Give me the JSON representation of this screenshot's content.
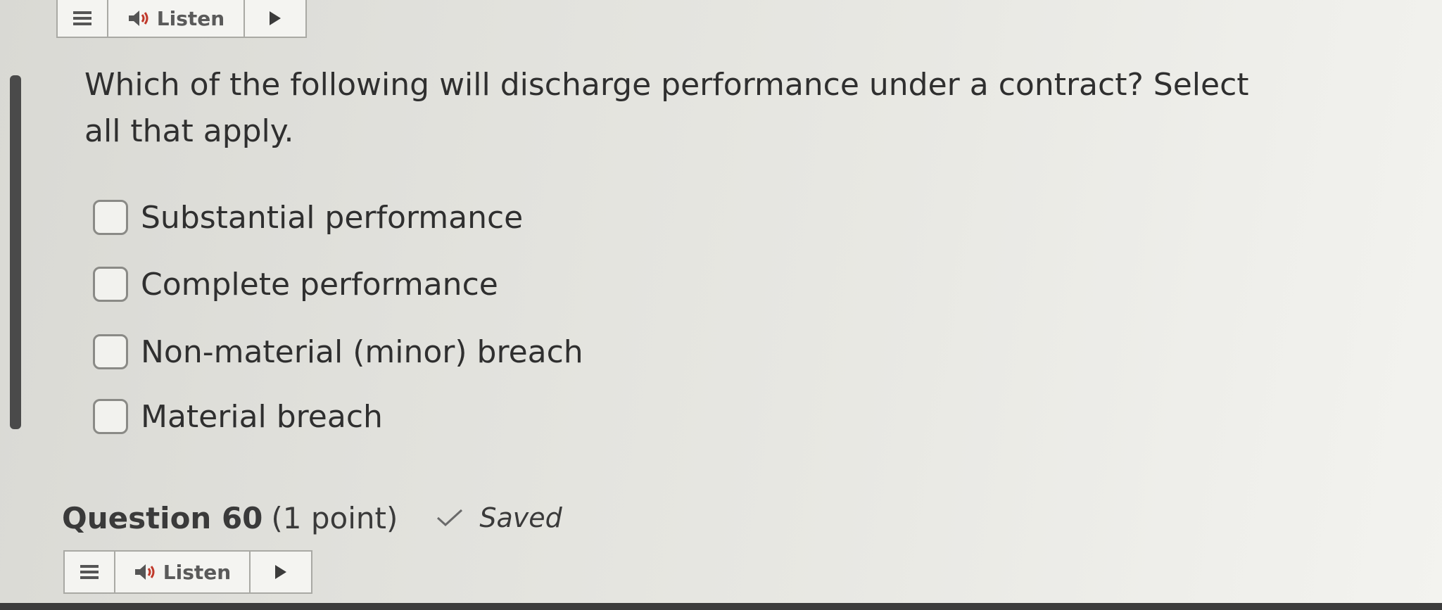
{
  "toolbar": {
    "listen_label": "Listen"
  },
  "question": {
    "text": "Which of the following will discharge performance under a contract? Select all that apply."
  },
  "options": [
    {
      "label": "Substantial performance",
      "checked": false
    },
    {
      "label": "Complete performance",
      "checked": false
    },
    {
      "label": "Non-material (minor) breach",
      "checked": false
    },
    {
      "label": "Material breach",
      "checked": false
    }
  ],
  "next_question": {
    "number": "Question 60",
    "points": "(1 point)",
    "status": "Saved"
  },
  "icons": {
    "menu": "menu-icon",
    "speaker": "speaker-icon",
    "play": "play-icon",
    "check": "check-icon"
  }
}
